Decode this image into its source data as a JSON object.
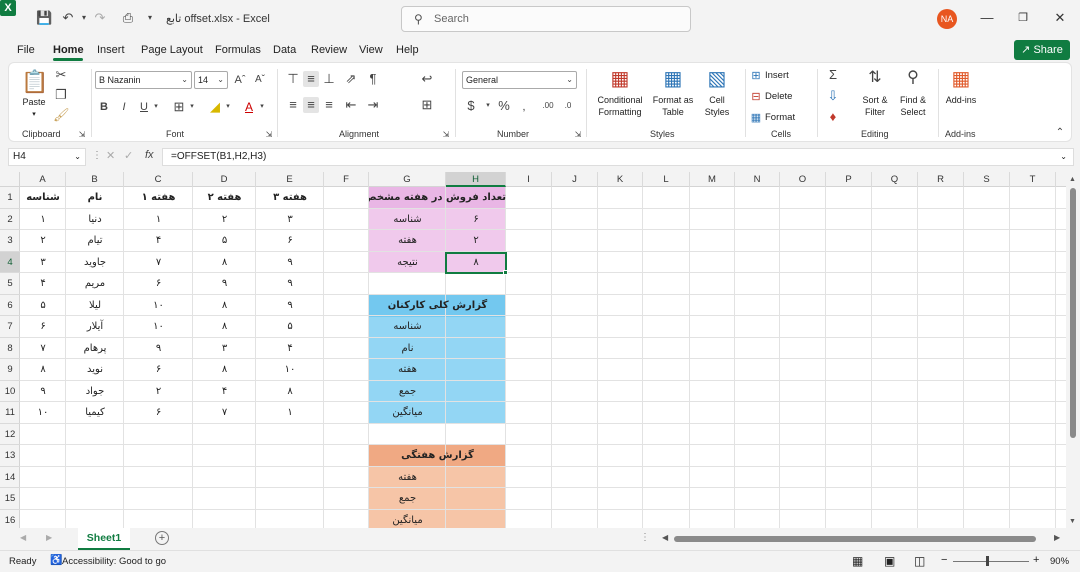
{
  "app": {
    "doc_title": "تابع offset.xlsx  -  Excel",
    "search_placeholder": "Search",
    "avatar_initials": "NA",
    "share_label": "Share"
  },
  "menu": [
    "File",
    "Home",
    "Insert",
    "Page Layout",
    "Formulas",
    "Data",
    "Review",
    "View",
    "Help"
  ],
  "ribbon": {
    "clipboard": {
      "label": "Clipboard",
      "paste": "Paste"
    },
    "font": {
      "label": "Font",
      "name": "B Nazanin",
      "size": "14"
    },
    "alignment": {
      "label": "Alignment"
    },
    "number": {
      "label": "Number",
      "format": "General"
    },
    "styles": {
      "label": "Styles",
      "conditional": "Conditional",
      "conditional2": "Formatting",
      "format_table": "Format as",
      "format_table2": "Table",
      "cell_styles": "Cell",
      "cell_styles2": "Styles"
    },
    "cells": {
      "label": "Cells",
      "insert": "Insert",
      "delete": "Delete",
      "format": "Format"
    },
    "editing": {
      "label": "Editing",
      "sort": "Sort &",
      "sort2": "Filter",
      "find": "Find &",
      "find2": "Select"
    },
    "addins": {
      "label": "Add-ins",
      "btn": "Add-ins"
    }
  },
  "formula_bar": {
    "name_box": "H4",
    "formula": "=OFFSET(B1,H2,H3)"
  },
  "columns": [
    "A",
    "B",
    "C",
    "D",
    "E",
    "F",
    "G",
    "H",
    "I",
    "J",
    "K",
    "L",
    "M",
    "N",
    "O",
    "P",
    "Q",
    "R",
    "S",
    "T"
  ],
  "rows": [
    "1",
    "2",
    "3",
    "4",
    "5",
    "6",
    "7",
    "8",
    "9",
    "10",
    "11",
    "12",
    "13",
    "14",
    "15",
    "16"
  ],
  "table": {
    "headers": [
      "شناسه",
      "نام",
      "هفته ۱",
      "هفته ۲",
      "هفته ۳"
    ],
    "rows": [
      [
        "۱",
        "دنیا",
        "۱",
        "۲",
        "۳"
      ],
      [
        "۲",
        "تیام",
        "۴",
        "۵",
        "۶"
      ],
      [
        "۳",
        "جاوید",
        "۷",
        "۸",
        "۹"
      ],
      [
        "۴",
        "مریم",
        "۶",
        "۹",
        "۹"
      ],
      [
        "۵",
        "لیلا",
        "۱۰",
        "۸",
        "۹"
      ],
      [
        "۶",
        "آیلار",
        "۱۰",
        "۸",
        "۵"
      ],
      [
        "۷",
        "پرهام",
        "۹",
        "۳",
        "۴"
      ],
      [
        "۸",
        "نوید",
        "۶",
        "۸",
        "۱۰"
      ],
      [
        "۹",
        "جواد",
        "۲",
        "۴",
        "۸"
      ],
      [
        "۱۰",
        "کیمیا",
        "۶",
        "۷",
        "۱"
      ]
    ]
  },
  "box1": {
    "title": "تعداد فروش در هفته مشخص",
    "labels": [
      "شناسه",
      "هفته",
      "نتیجه"
    ],
    "values": [
      "۶",
      "۲",
      "۸"
    ],
    "color": "#f0c9ec",
    "title_color": "#e9b6e5"
  },
  "box2": {
    "title": "گزارش کلی کارکنان",
    "labels": [
      "شناسه",
      "نام",
      "هفته",
      "جمع",
      "میانگین"
    ],
    "color": "#93d6f4",
    "title_color": "#73c8ef"
  },
  "box3": {
    "title": "گزارش هفتگی",
    "labels": [
      "هفته",
      "جمع",
      "میانگین"
    ],
    "color": "#f6c5a7",
    "title_color": "#f0a983"
  },
  "sheet_tab": "Sheet1",
  "status": {
    "ready": "Ready",
    "accessibility": "Accessibility: Good to go",
    "zoom": "90%"
  },
  "accent": "#107c41"
}
